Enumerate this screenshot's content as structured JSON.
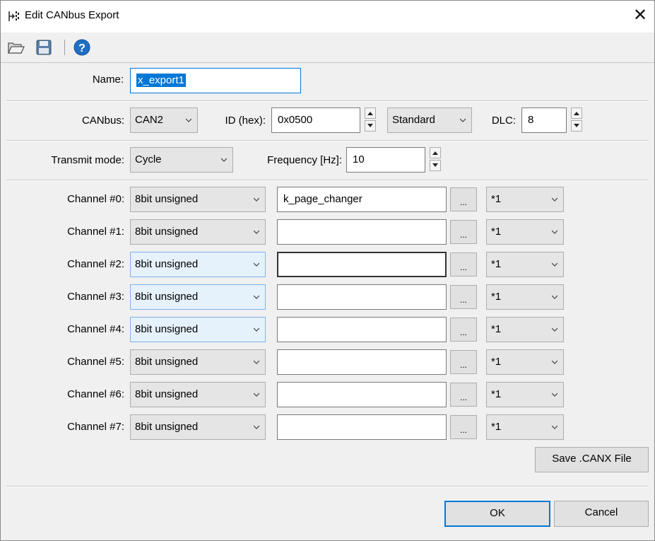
{
  "window": {
    "title": "Edit CANbus Export",
    "close_glyph": "✕"
  },
  "toolbar": {
    "icons": [
      "open-folder-icon",
      "save-disk-icon",
      "help-icon"
    ]
  },
  "name_row": {
    "label": "Name:",
    "value": "x_export1"
  },
  "bus_row": {
    "canbus_label": "CANbus:",
    "canbus_value": "CAN2",
    "id_label": "ID (hex):",
    "id_value": "0x0500",
    "frame_value": "Standard",
    "dlc_label": "DLC:",
    "dlc_value": "8"
  },
  "mode_row": {
    "mode_label": "Transmit mode:",
    "mode_value": "Cycle",
    "freq_label": "Frequency [Hz]:",
    "freq_value": "10"
  },
  "channels": [
    {
      "label": "Channel #0:",
      "type": "8bit unsigned",
      "variable": "k_page_changer",
      "ellipsis": "...",
      "factor": "*1"
    },
    {
      "label": "Channel #1:",
      "type": "8bit unsigned",
      "variable": "",
      "ellipsis": "...",
      "factor": "*1"
    },
    {
      "label": "Channel #2:",
      "type": "8bit unsigned",
      "variable": "",
      "ellipsis": "...",
      "factor": "*1"
    },
    {
      "label": "Channel #3:",
      "type": "8bit unsigned",
      "variable": "",
      "ellipsis": "...",
      "factor": "*1"
    },
    {
      "label": "Channel #4:",
      "type": "8bit unsigned",
      "variable": "",
      "ellipsis": "...",
      "factor": "*1"
    },
    {
      "label": "Channel #5:",
      "type": "8bit unsigned",
      "variable": "",
      "ellipsis": "...",
      "factor": "*1"
    },
    {
      "label": "Channel #6:",
      "type": "8bit unsigned",
      "variable": "",
      "ellipsis": "...",
      "factor": "*1"
    },
    {
      "label": "Channel #7:",
      "type": "8bit unsigned",
      "variable": "",
      "ellipsis": "...",
      "factor": "*1"
    }
  ],
  "buttons": {
    "save_canx": "Save .CANX File",
    "ok": "OK",
    "cancel": "Cancel"
  },
  "colors": {
    "accent": "#0078d7",
    "dialog_bg": "#f0f0f0",
    "help_icon": "#1f6fc5"
  }
}
